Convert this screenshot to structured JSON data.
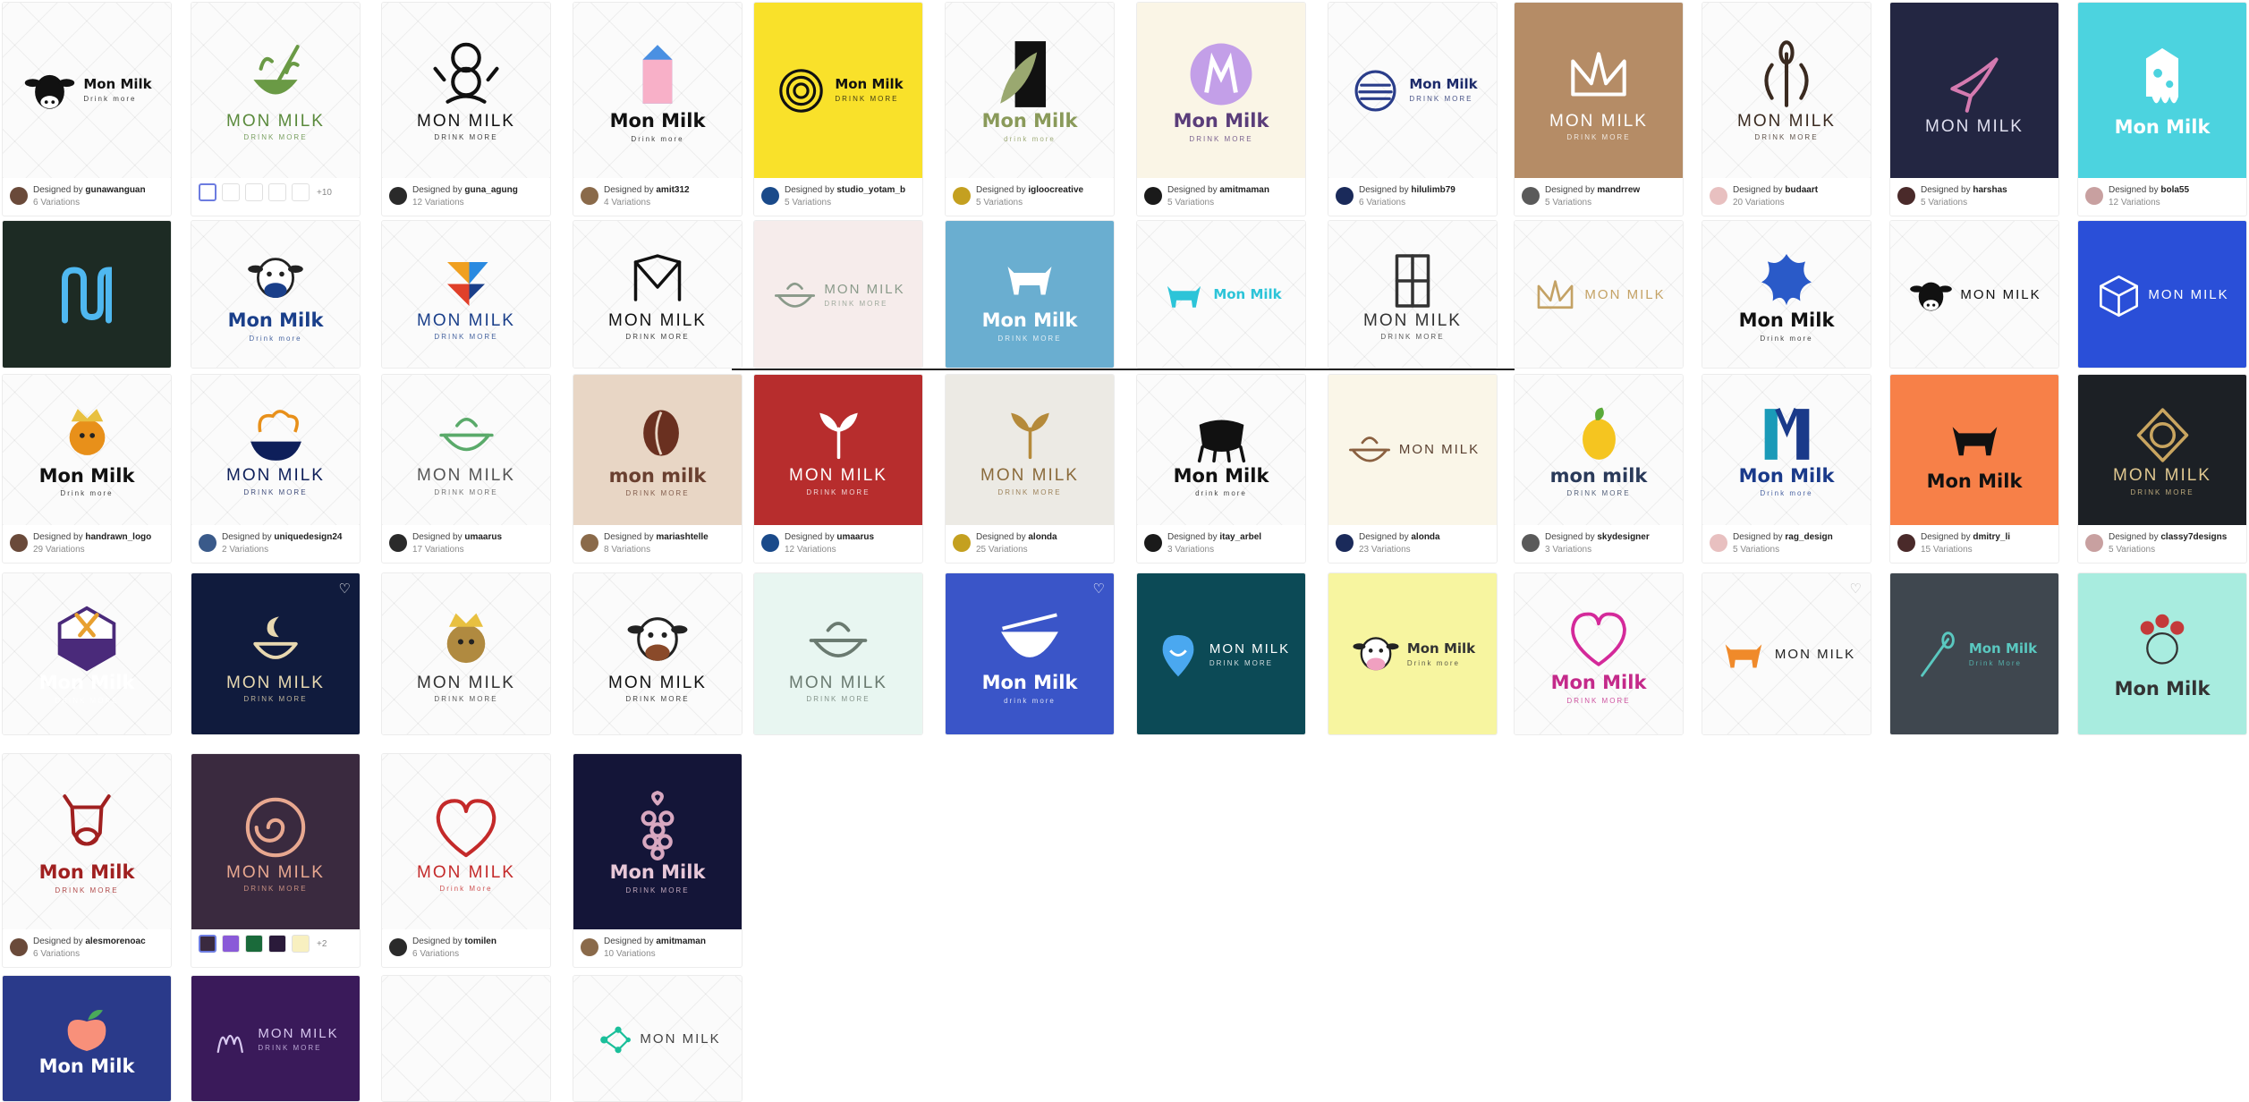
{
  "credit_prefix": "Designed by",
  "cards": [
    {
      "id": "c1",
      "brand": "Mon Milk",
      "tagline": "Drink more",
      "emblem": "cow-head-icon",
      "bg": "#ffffff",
      "fg": "#111111",
      "accent": "#111111",
      "designer": "gunawanguan",
      "variations": "6 Variations",
      "layout": "left"
    },
    {
      "id": "c2",
      "brand": "MON MILK",
      "tagline": "DRINK MORE",
      "emblem": "whisk-bowl-icon",
      "bg": "#fafaf7",
      "fg": "#5a8a3c",
      "accent": "#6a9a45",
      "swatches": true,
      "swatch_more": "+10"
    },
    {
      "id": "c3",
      "brand": "MON MILK",
      "tagline": "DRINK MORE",
      "emblem": "chef-icon",
      "bg": "#ffffff",
      "fg": "#111111",
      "accent": "#111111",
      "designer": "guna_agung",
      "variations": "12 Variations"
    },
    {
      "id": "c4",
      "brand": "Mon Milk",
      "tagline": "Drink more",
      "emblem": "milk-carton-icon",
      "bg": "#ffffff",
      "fg": "#111111",
      "accent": "#4a90e2",
      "designer": "amit312",
      "variations": "4 Variations"
    },
    {
      "id": "c5",
      "brand": "Mon Milk",
      "tagline": "DRINK MORE",
      "emblem": "spiral-icon",
      "bg": "#f9e12a",
      "fg": "#111111",
      "accent": "#111111",
      "designer": "studio_yotam_b",
      "variations": "5 Variations",
      "layout": "left"
    },
    {
      "id": "c6",
      "brand": "Mon Milk",
      "tagline": "drink more",
      "emblem": "leaf-block-icon",
      "bg": "#ffffff",
      "fg": "#8a9a5a",
      "accent": "#111111",
      "designer": "igloocreative",
      "variations": "5 Variations"
    },
    {
      "id": "c7",
      "brand": "Mon Milk",
      "tagline": "DRINK MORE",
      "emblem": "watercolor-m-icon",
      "bg": "#faf5e6",
      "fg": "#5a3d7a",
      "accent": "#9a6ad8",
      "designer": "amitmaman",
      "variations": "5 Variations"
    },
    {
      "id": "c8",
      "brand": "Mon Milk",
      "tagline": "DRINK MORE",
      "emblem": "circle-lines-icon",
      "bg": "#f2f2f2",
      "fg": "#1c2a6a",
      "accent": "#2a3d8a",
      "designer": "hilulimb79",
      "variations": "6 Variations",
      "layout": "left"
    },
    {
      "id": "c9",
      "brand": "MON MILK",
      "tagline": "DRINK MORE",
      "emblem": "line-crown-icon",
      "bg": "#b58c66",
      "fg": "#ffffff",
      "accent": "#ffffff",
      "designer": "mandrrew",
      "variations": "5 Variations"
    },
    {
      "id": "c10",
      "brand": "MON MILK",
      "tagline": "DRINK MORE",
      "emblem": "whisk-laurel-icon",
      "bg": "#f7f5f2",
      "fg": "#3a2a20",
      "accent": "#3a2a20",
      "designer": "budaart",
      "variations": "20 Variations"
    },
    {
      "id": "c11",
      "brand": "MON MILK",
      "tagline": "",
      "emblem": "hummingbird-icon",
      "bg": "#232642",
      "fg": "#e0e0f0",
      "accent": "#d47ab0",
      "designer": "harshas",
      "variations": "5 Variations"
    },
    {
      "id": "c12",
      "brand": "Mon Milk",
      "tagline": "",
      "emblem": "dripping-carton-icon",
      "bg": "#4cd3df",
      "fg": "#ffffff",
      "accent": "#ffffff",
      "designer": "bola55",
      "variations": "12 Variations"
    },
    {
      "id": "c13",
      "brand": "",
      "tagline": "",
      "emblem": "pipe-m-icon",
      "bg": "#1d2b24",
      "fg": "#ffffff",
      "accent": "#4fb8f0"
    },
    {
      "id": "c14",
      "brand": "Mon Milk",
      "tagline": "Drink more",
      "emblem": "cartoon-cow-icon",
      "bg": "#ffffff",
      "fg": "#1a3f8a",
      "accent": "#1a3f8a"
    },
    {
      "id": "c15",
      "brand": "MON MILK",
      "tagline": "DRINK MORE",
      "emblem": "geometric-bird-icon",
      "bg": "#ffffff",
      "fg": "#1a3f8a",
      "accent": "#2a8ae0"
    },
    {
      "id": "c16",
      "brand": "MON MILK",
      "tagline": "DRINK MORE",
      "emblem": "monogram-m-icon",
      "bg": "#ffffff",
      "fg": "#111111",
      "accent": "#111111"
    },
    {
      "id": "c17",
      "brand": "MON MILK",
      "tagline": "DRINK MORE",
      "emblem": "pot-outline-icon",
      "bg": "#f6eceb",
      "fg": "#8a9a8a",
      "accent": "#8a9a8a",
      "layout": "left"
    },
    {
      "id": "c18",
      "brand": "Mon Milk",
      "tagline": "DRINK MORE",
      "emblem": "white-cow-icon",
      "bg": "#6aaed0",
      "fg": "#ffffff",
      "accent": "#ffffff"
    },
    {
      "id": "c19",
      "brand": "Mon Milk",
      "tagline": "",
      "emblem": "cyan-cow-icon",
      "bg": "#ffffff",
      "fg": "#2cc4d8",
      "accent": "#2cc4d8",
      "layout": "left"
    },
    {
      "id": "c20",
      "brand": "MON MILK",
      "tagline": "DRINK MORE",
      "emblem": "square-ornament-icon",
      "bg": "#ffffff",
      "fg": "#333333",
      "accent": "#333333"
    },
    {
      "id": "c21",
      "brand": "MON MILK",
      "tagline": "",
      "emblem": "gold-crown-icon",
      "bg": "#ffffff",
      "fg": "#c4a265",
      "accent": "#c4a265",
      "layout": "left"
    },
    {
      "id": "c22",
      "brand": "Mon Milk",
      "tagline": "Drink more",
      "emblem": "milk-splash-icon",
      "bg": "#ffffff",
      "fg": "#111111",
      "accent": "#2a5ac8"
    },
    {
      "id": "c23",
      "brand": "MON MILK",
      "tagline": "",
      "emblem": "round-cow-icon",
      "bg": "#ffffff",
      "fg": "#111111",
      "accent": "#111111",
      "layout": "left"
    },
    {
      "id": "c24",
      "brand": "MON MILK",
      "tagline": "",
      "emblem": "cube-icon",
      "bg": "#2a4fd8",
      "fg": "#ffffff",
      "accent": "#ffffff",
      "layout": "left"
    },
    {
      "id": "c25",
      "brand": "Mon Milk",
      "tagline": "Drink more",
      "emblem": "chef-cow-icon",
      "bg": "#ffffff",
      "fg": "#111111",
      "accent": "#e8901a",
      "designer": "handrawn_logo",
      "variations": "29 Variations"
    },
    {
      "id": "c26",
      "brand": "MON MILK",
      "tagline": "DRINK MORE",
      "emblem": "chef-hat-bowl-icon",
      "bg": "#ffffff",
      "fg": "#0e1f5a",
      "accent": "#e8901a",
      "designer": "uniquedesign24",
      "variations": "2 Variations"
    },
    {
      "id": "c27",
      "brand": "MON MILK",
      "tagline": "DRINK MORE",
      "emblem": "green-bowl-icon",
      "bg": "#ffffff",
      "fg": "#555555",
      "accent": "#5aaa6a",
      "designer": "umaarus",
      "variations": "17 Variations"
    },
    {
      "id": "c28",
      "brand": "mon milk",
      "tagline": "DRINK MORE",
      "emblem": "coffee-bean-icon",
      "bg": "#e8d6c5",
      "fg": "#6a4030",
      "accent": "#6a3020",
      "designer": "mariashtelle",
      "variations": "8 Variations"
    },
    {
      "id": "c29",
      "brand": "MON MILK",
      "tagline": "DRINK MORE",
      "emblem": "lotus-icon",
      "bg": "#b72d2d",
      "fg": "#ffffff",
      "accent": "#ffffff",
      "designer": "umaarus",
      "variations": "12 Variations"
    },
    {
      "id": "c30",
      "brand": "MON MILK",
      "tagline": "DRINK MORE",
      "emblem": "sprout-icon",
      "bg": "#eceae4",
      "fg": "#8a6a3a",
      "accent": "#b58a3a",
      "designer": "alonda",
      "variations": "25 Variations"
    },
    {
      "id": "c31",
      "brand": "Mon Milk",
      "tagline": "drink more",
      "emblem": "cauldron-icon",
      "bg": "#ffffff",
      "fg": "#111111",
      "accent": "#111111",
      "designer": "itay_arbel",
      "variations": "3 Variations"
    },
    {
      "id": "c32",
      "brand": "MON MILK",
      "tagline": "",
      "emblem": "mortar-icon",
      "bg": "#faf6e8",
      "fg": "#5a4030",
      "accent": "#8a6040",
      "designer": "alonda",
      "variations": "23 Variations",
      "layout": "left"
    },
    {
      "id": "c33",
      "brand": "mon milk",
      "tagline": "DRINK MORE",
      "emblem": "lemon-icon",
      "bg": "#ffffff",
      "fg": "#2a3a5a",
      "accent": "#f0c020",
      "designer": "skydesigner",
      "variations": "3 Variations"
    },
    {
      "id": "c34",
      "brand": "Mon Milk",
      "tagline": "Drink more",
      "emblem": "teal-m-icon",
      "bg": "#ffffff",
      "fg": "#1a3a8a",
      "accent": "#1a9ab8",
      "designer": "rag_design",
      "variations": "5 Variations"
    },
    {
      "id": "c35",
      "brand": "Mon Milk",
      "tagline": "",
      "emblem": "running-cow-icon",
      "bg": "#f78048",
      "fg": "#111111",
      "accent": "#111111",
      "designer": "dmitry_li",
      "variations": "15 Variations"
    },
    {
      "id": "c36",
      "brand": "MON MILK",
      "tagline": "DRINK MORE",
      "emblem": "gold-knot-icon",
      "bg": "#1c2025",
      "fg": "#e0c890",
      "accent": "#c9a560",
      "designer": "classy7designs",
      "variations": "5 Variations"
    },
    {
      "id": "c37",
      "brand": "Mon Milk",
      "tagline": "DRINK MORE",
      "emblem": "spoon-fork-badge-icon",
      "bg": "#ffffff",
      "fg": "#ffffff",
      "accent": "#4a2a7a"
    },
    {
      "id": "c38",
      "brand": "MON MILK",
      "tagline": "DRINK MORE",
      "emblem": "moon-bowl-icon",
      "bg": "#101b3d",
      "fg": "#e8d8b0",
      "accent": "#e8d8b0",
      "heart": true
    },
    {
      "id": "c39",
      "brand": "MON MILK",
      "tagline": "DRINK MORE",
      "emblem": "lion-king-icon",
      "bg": "#ffffff",
      "fg": "#333333",
      "accent": "#b08a40"
    },
    {
      "id": "c40",
      "brand": "MON MILK",
      "tagline": "DRINK MORE",
      "emblem": "brown-cow-icon",
      "bg": "#ffffff",
      "fg": "#111111",
      "accent": "#8a4a2a"
    },
    {
      "id": "c41",
      "brand": "MON MILK",
      "tagline": "DRINK MORE",
      "emblem": "rice-bowl-icon",
      "bg": "#e8f6f1",
      "fg": "#6a7a70",
      "accent": "#6a7a70"
    },
    {
      "id": "c42",
      "brand": "Mon Milk",
      "tagline": "drink more",
      "emblem": "white-bowl-icon",
      "bg": "#3a55c8",
      "fg": "#ffffff",
      "accent": "#ffffff",
      "heart": true
    },
    {
      "id": "c43",
      "brand": "MON MILK",
      "tagline": "DRINK MORE",
      "emblem": "location-pin-icon",
      "bg": "#0c4a56",
      "fg": "#ffffff",
      "accent": "#4aa8f0",
      "layout": "left"
    },
    {
      "id": "c44",
      "brand": "Mon Milk",
      "tagline": "Drink more",
      "emblem": "cow-face-icon",
      "bg": "#f7f5a0",
      "fg": "#333333",
      "accent": "#f0a0c0",
      "layout": "left"
    },
    {
      "id": "c45",
      "brand": "Mon Milk",
      "tagline": "DRINK MORE",
      "emblem": "heart-hat-icon",
      "bg": "#ffffff",
      "fg": "#c42a8a",
      "accent": "#d42a9a"
    },
    {
      "id": "c46",
      "brand": "MON MILK",
      "tagline": "",
      "emblem": "orange-cow-icon",
      "bg": "#ffffff",
      "fg": "#222222",
      "accent": "#f08a2a",
      "layout": "left",
      "heart": true,
      "heart_dark": true
    },
    {
      "id": "c47",
      "brand": "Mon Milk",
      "tagline": "Drink More",
      "emblem": "whisk-teal-icon",
      "bg": "#3f474f",
      "fg": "#5ac8c0",
      "accent": "#5ac8c0",
      "layout": "left"
    },
    {
      "id": "c48",
      "brand": "Mon Milk",
      "tagline": "",
      "emblem": "floral-woman-icon",
      "bg": "#a8ecdf",
      "fg": "#333333",
      "accent": "#c43a3a"
    },
    {
      "id": "c49",
      "brand": "Mon Milk",
      "tagline": "DRINK MORE",
      "emblem": "red-cow-outline-icon",
      "bg": "#ffffff",
      "fg": "#a02020",
      "accent": "#a02020",
      "designer": "alesmorenoac",
      "variations": "6 Variations"
    },
    {
      "id": "c50",
      "brand": "MON MILK",
      "tagline": "DRINK MORE",
      "emblem": "swirl-icon",
      "bg": "#3a2a3f",
      "fg": "#e8a890",
      "accent": "#e8a890",
      "swatches": true,
      "swatch_colors": [
        "#3a2a3f",
        "#8a5ad8",
        "#1a6a3a",
        "#2a1a3a",
        "#f8f0c0"
      ],
      "swatch_more": "+2"
    },
    {
      "id": "c51",
      "brand": "MON MILK",
      "tagline": "Drink More",
      "emblem": "heart-leaves-icon",
      "bg": "#ffffff",
      "fg": "#c42a2a",
      "accent": "#c42a2a",
      "designer": "tomilen",
      "variations": "6 Variations"
    },
    {
      "id": "c52",
      "brand": "Mon Milk",
      "tagline": "DRINK MORE",
      "emblem": "grapes-icon",
      "bg": "#141538",
      "fg": "#e8c8d8",
      "accent": "#d8a8c0",
      "designer": "amitmaman",
      "variations": "10 Variations"
    },
    {
      "id": "c53",
      "brand": "Mon Milk",
      "tagline": "",
      "emblem": "peach-icon",
      "bg": "#2a3a8a",
      "fg": "#ffffff",
      "accent": "#f8907a"
    },
    {
      "id": "c54",
      "brand": "MON MILK",
      "tagline": "DRINK MORE",
      "emblem": "script-m-icon",
      "bg": "#3a1a5a",
      "fg": "#d8c8f0",
      "accent": "#d8c8f0",
      "layout": "left"
    },
    {
      "id": "c55",
      "brand": "",
      "tagline": "",
      "emblem": "",
      "bg": "#fbfbfb",
      "fg": "#111111",
      "accent": "#111111"
    },
    {
      "id": "c56",
      "brand": "MON MILK",
      "tagline": "",
      "emblem": "molecule-icon",
      "bg": "#ffffff",
      "fg": "#444444",
      "accent": "#1abf9a",
      "layout": "left"
    }
  ]
}
